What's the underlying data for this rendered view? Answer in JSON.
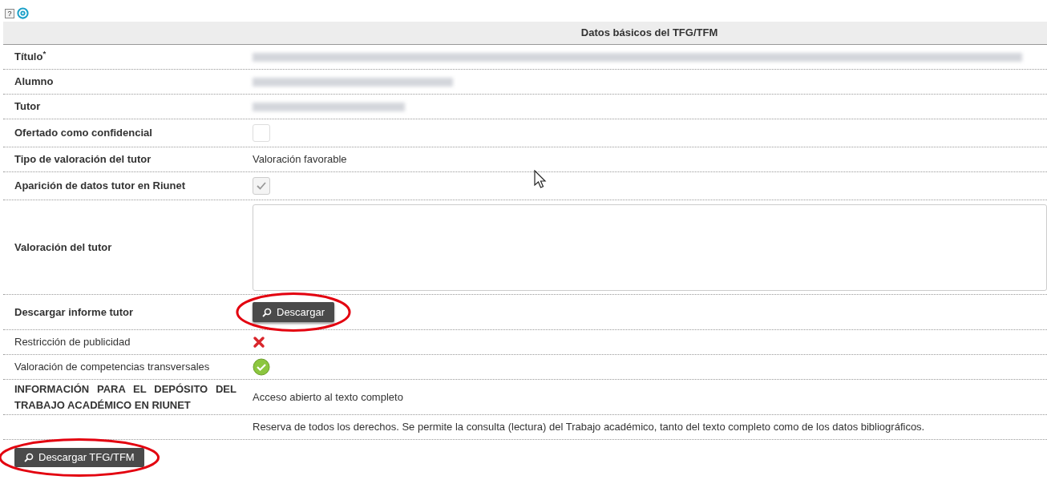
{
  "toolbar": {
    "help_icon": "?"
  },
  "table": {
    "header": "Datos básicos del TFG/TFM",
    "rows": [
      {
        "kind": "redacted",
        "label": "Título$^{*}$",
        "bold": true
      },
      {
        "kind": "redacted",
        "label": "Alumno",
        "bold": true
      },
      {
        "kind": "redacted",
        "label": "Tutor",
        "bold": true
      },
      {
        "kind": "checkbox",
        "label": "Ofertado como confidencial",
        "bold": true,
        "checked": false,
        "disabled": false
      },
      {
        "kind": "text",
        "label": "Tipo de valoración del tutor",
        "bold": true,
        "value": "Valoración favorable"
      },
      {
        "kind": "checkbox",
        "label": "Aparición de datos tutor en Riunet",
        "bold": true,
        "checked": true,
        "disabled": true
      },
      {
        "kind": "textarea",
        "label": "Valoración del tutor",
        "bold": true
      },
      {
        "kind": "button",
        "label": "Descargar informe tutor",
        "bold": true,
        "button": "Descargar",
        "circled": true
      },
      {
        "kind": "status",
        "label": "Restricción de publicidad",
        "bold": false,
        "ok": false
      },
      {
        "kind": "status",
        "label": "Valoración de competencias transversales",
        "bold": false,
        "ok": true
      },
      {
        "kind": "text",
        "label": "INFORMACIÓN PARA EL DEPÓSITO DEL TRABAJO ACADÉMICO EN RIUNET",
        "bold": true,
        "value": "Acceso abierto al texto completo"
      },
      {
        "kind": "text",
        "value": "Reserva de todos los derechos. Se permite la consulta (lectura) del Trabajo académico, tanto del texto completo como de los datos bibliográficos."
      }
    ]
  },
  "footer_button": {
    "label": "Descargar TFG/TFM",
    "circled": true
  }
}
